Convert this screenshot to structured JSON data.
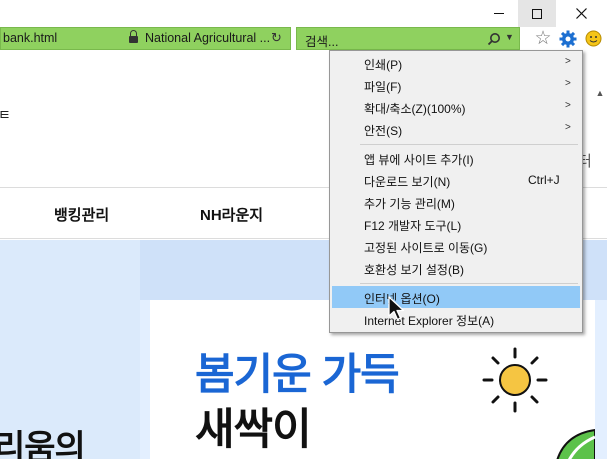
{
  "browser": {
    "address_bar": {
      "url_fragment": "bank.html",
      "site_identity": "National Agricultural ..."
    },
    "search": {
      "placeholder": "검색..."
    }
  },
  "page": {
    "header_fragment_left": "ㅌ",
    "header_fragment_right": "터",
    "nav": {
      "banking": "뱅킹관리",
      "lounge": "NH라운지"
    },
    "hero": {
      "headline_line1": "봄기운 가득",
      "headline_line2": "새싹이",
      "left_fragment": "리움의"
    }
  },
  "tools_menu": {
    "items": [
      {
        "label": "인쇄(P)",
        "submenu": true
      },
      {
        "label": "파일(F)",
        "submenu": true
      },
      {
        "label": "확대/축소(Z)(100%)",
        "submenu": true
      },
      {
        "label": "안전(S)",
        "submenu": true
      },
      {
        "label": "앱 뷰에 사이트 추가(I)"
      },
      {
        "label": "다운로드 보기(N)",
        "shortcut": "Ctrl+J"
      },
      {
        "label": "추가 기능 관리(M)"
      },
      {
        "label": "F12 개발자 도구(L)"
      },
      {
        "label": "고정된 사이트로 이동(G)"
      },
      {
        "label": "호환성 보기 설정(B)"
      },
      {
        "label": "인터넷 옵션(O)",
        "highlighted": true
      },
      {
        "label": "Internet Explorer 정보(A)"
      }
    ],
    "submenu_arrow": ">"
  },
  "icons": {
    "favorites": "star-icon",
    "tools": "gear-icon",
    "feedback": "smiley-icon",
    "refresh": "refresh-icon",
    "lock": "lock-icon",
    "search": "search-icon"
  },
  "colors": {
    "address_bar": "#8fd15f",
    "menu_background": "#f0f0f0",
    "menu_highlight": "#91c9f7",
    "headline_blue": "#1a66d4",
    "gear_blue": "#1c6fd1",
    "smiley_yellow": "#f5c518"
  }
}
